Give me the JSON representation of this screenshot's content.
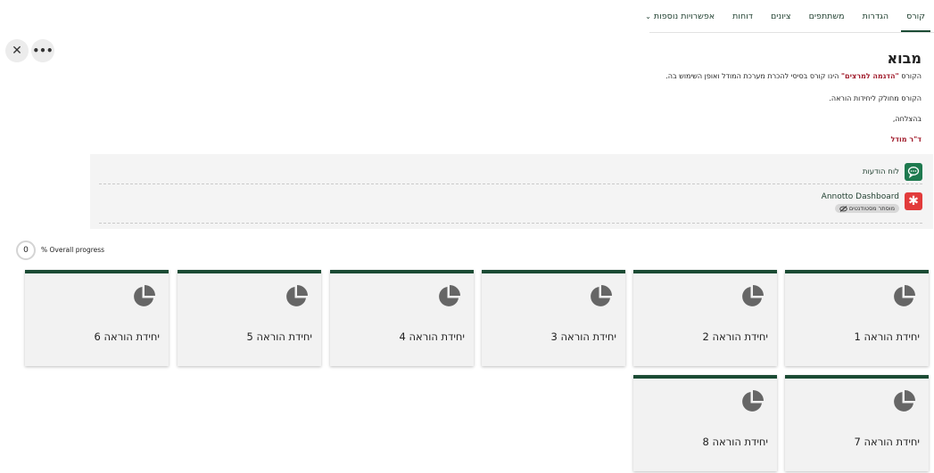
{
  "nav": {
    "tabs": [
      {
        "label": "קורס",
        "active": true
      },
      {
        "label": "הגדרות"
      },
      {
        "label": "משתתפים"
      },
      {
        "label": "ציונים"
      },
      {
        "label": "דוחות"
      }
    ],
    "more_label": "אפשרויות נוספות"
  },
  "actions": {
    "close": "✕",
    "more": "•••"
  },
  "section": {
    "title": "מבוא",
    "line1_pre": "הקורס ",
    "line1_highlight": "\"הדגמה למרצים\"",
    "line1_post": " הינו קורס בסיסי להכרת מערכת המודל ואופן השימוש בה.",
    "line2": "הקורס מחולק ליחידות הוראה.",
    "line3": "בהצלחה,",
    "signature": "ד\"ר מודל"
  },
  "activities": {
    "forum": {
      "label": "לוח הודעות",
      "icon": "forum-icon"
    },
    "lti": {
      "label": "Annotto Dashboard",
      "icon": "lti-icon",
      "badge": "מוסתר מסטודנטים"
    }
  },
  "progress": {
    "value": "0",
    "label": "% Overall progress"
  },
  "units": [
    {
      "name": "יחידת הוראה 1"
    },
    {
      "name": "יחידת הוראה 2"
    },
    {
      "name": "יחידת הוראה 3"
    },
    {
      "name": "יחידת הוראה 4"
    },
    {
      "name": "יחידת הוראה 5"
    },
    {
      "name": "יחידת הוראה 6"
    },
    {
      "name": "יחידת הוראה 7"
    },
    {
      "name": "יחידת הוראה 8"
    }
  ],
  "colors": {
    "brand": "#1b4b34",
    "highlight": "#a11c2c",
    "forum_icon": "#1e7a4f",
    "lti_icon": "#e23b3b"
  }
}
